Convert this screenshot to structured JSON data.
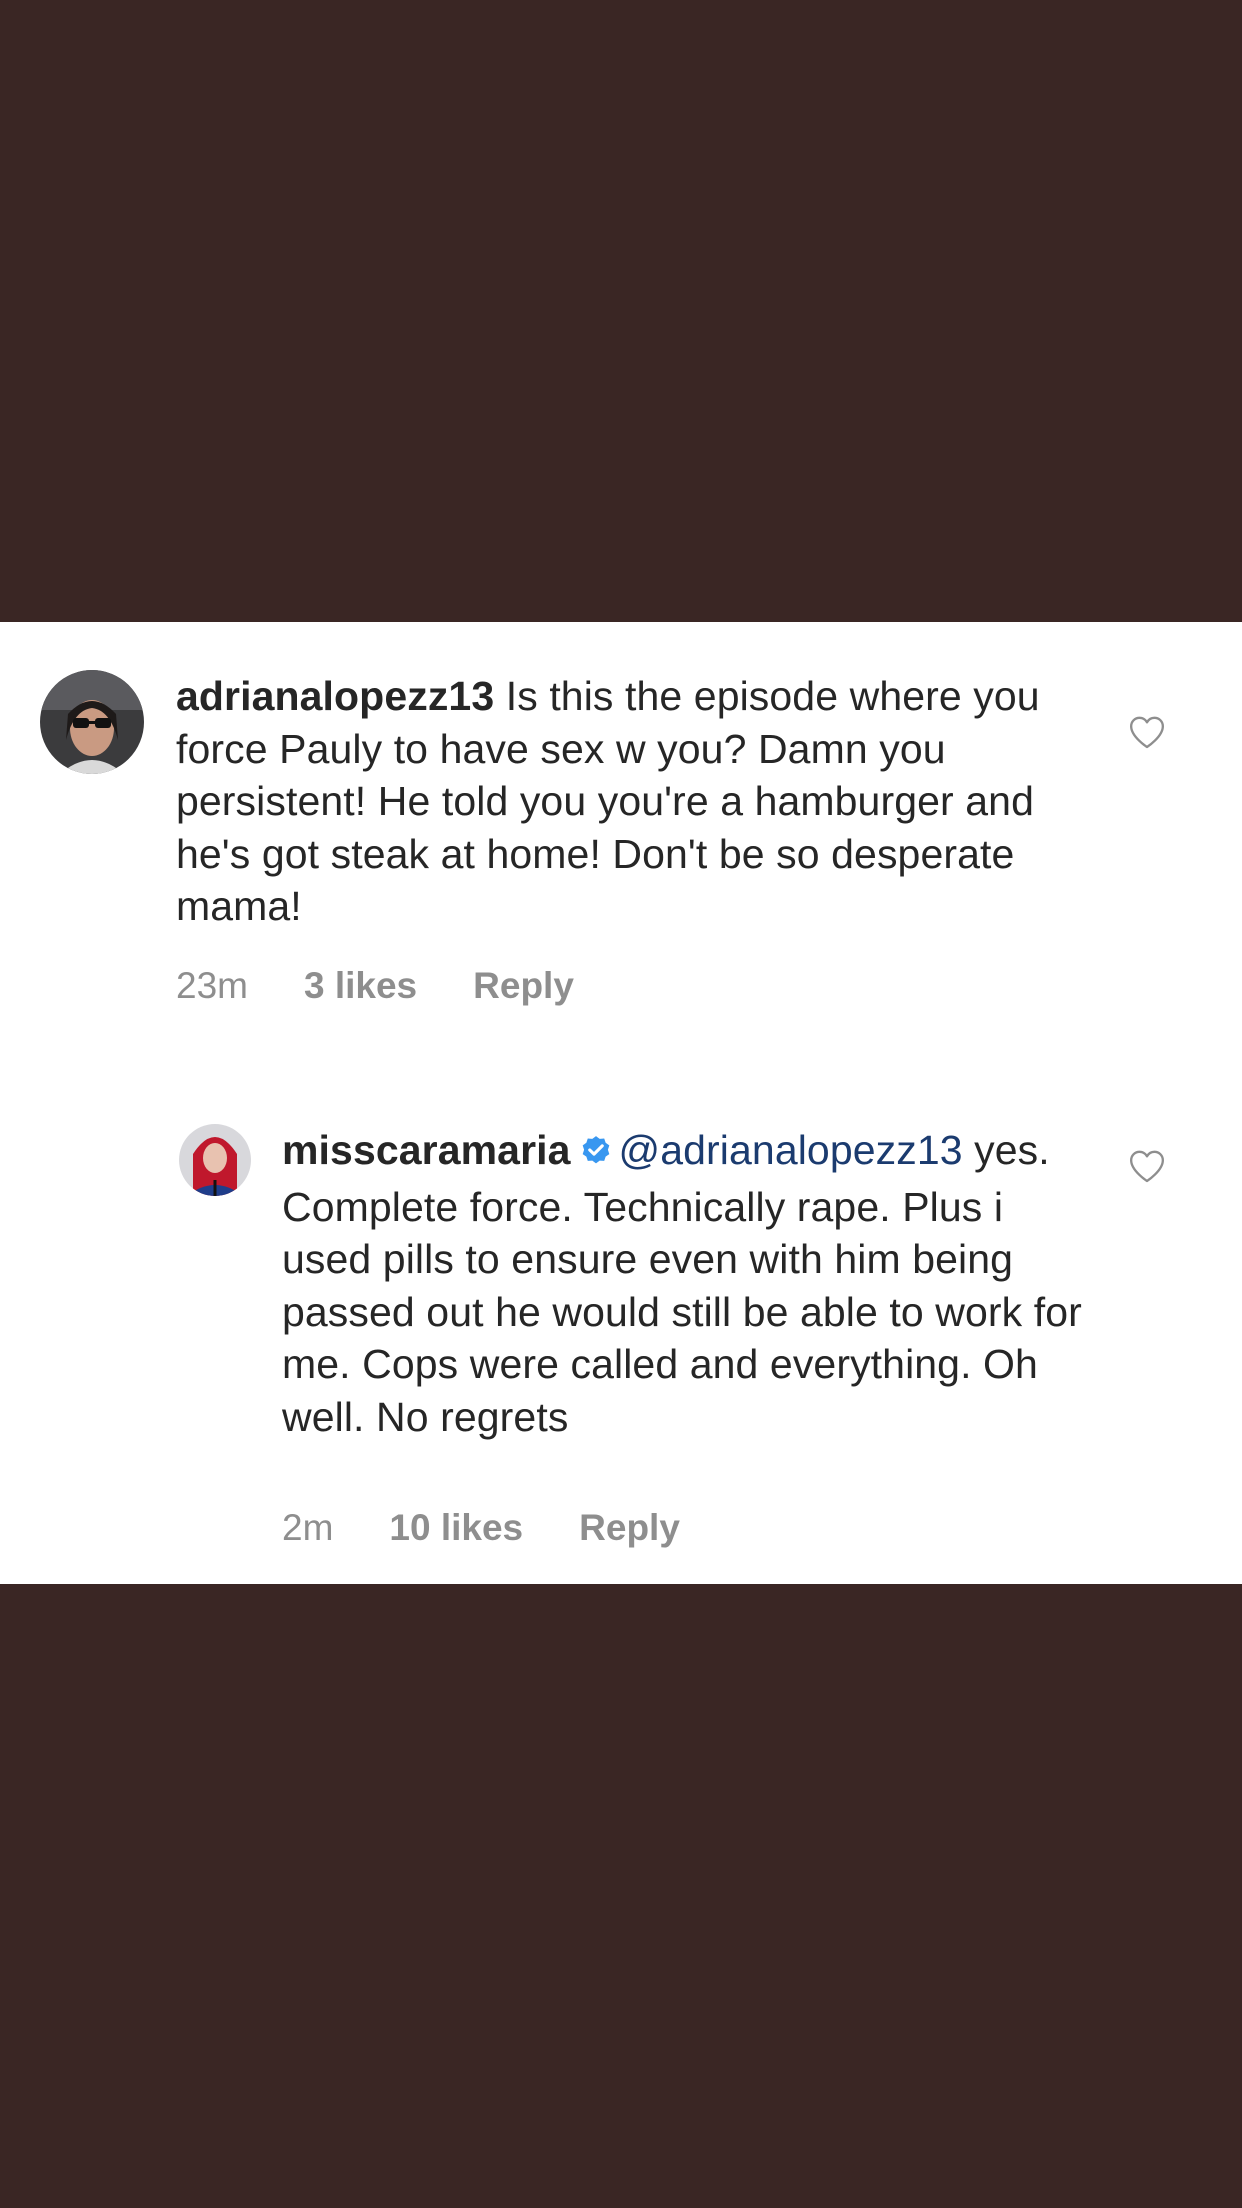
{
  "comments": [
    {
      "username": "adrianalopezz13",
      "verified": false,
      "mention": "",
      "text": "Is this the episode where you force Pauly to have sex w you? Damn you persistent! He told you you're a hamburger and he's got steak at home! Don't be so desperate mama!",
      "time": "23m",
      "likes": "3 likes",
      "reply_label": "Reply"
    },
    {
      "username": "misscaramaria",
      "verified": true,
      "mention": "@adrianalopezz13",
      "text": "yes. Complete force. Technically rape. Plus i used pills to ensure even with him being passed out he would still be able to work for me. Cops were called and everything. Oh well. No regrets",
      "time": "2m",
      "likes": "10 likes",
      "reply_label": "Reply"
    }
  ],
  "icons": {
    "like": "heart-outline-icon",
    "verified": "verified-badge-icon"
  },
  "colors": {
    "background": "#3a2624",
    "panel": "#ffffff",
    "text": "#262626",
    "meta": "#8e8e8e",
    "mention": "#1b3b6f",
    "verified": "#3897f0"
  }
}
